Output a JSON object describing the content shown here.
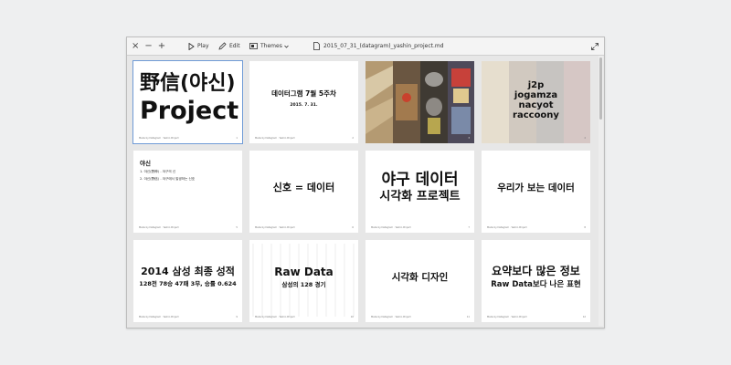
{
  "toolbar": {
    "close_icon": "×",
    "minimize_icon": "−",
    "add_icon": "+",
    "play_label": "Play",
    "edit_label": "Edit",
    "themes_label": "Themes",
    "file_name": "2015_07_31_(datagram)_yashin_project.md"
  },
  "slides": [
    {
      "title_line1": "野信(야신)",
      "title_line2": "Project",
      "footer": "Made by Datagram · Yashin Project",
      "page": "1"
    },
    {
      "title": "데이터그램 7월 5주차",
      "subtitle": "2015. 7. 31.",
      "footer": "Made by Datagram · Yashin Project",
      "page": "2"
    },
    {
      "image": "baseball-photo-collage",
      "page": "3"
    },
    {
      "line1": "j2p",
      "line2": "jogamza",
      "line3": "nacyot",
      "line4": "raccoony",
      "image": "faded-photo-collage",
      "page": "4"
    },
    {
      "heading": "야신",
      "item1": "1. 야신(野神) - 야구의 신",
      "item2": "2. 야신(野信) - 야구에서 발생하는 신호",
      "footer": "Made by Datagram · Yashin Project",
      "page": "5"
    },
    {
      "title": "신호 = 데이터",
      "footer": "Made by Datagram · Yashin Project",
      "page": "6"
    },
    {
      "line1": "야구 데이터",
      "line2": "시각화 프로젝트",
      "footer": "Made by Datagram · Yashin Project",
      "page": "7"
    },
    {
      "title": "우리가 보는 데이터",
      "footer": "Made by Datagram · Yashin Project",
      "page": "8"
    },
    {
      "line1": "2014 삼성 최종 성적",
      "line2": "128전 78승 47패 3무, 승률 0.624",
      "footer": "Made by Datagram · Yashin Project",
      "page": "9"
    },
    {
      "title": "Raw Data",
      "subtitle": "삼성의 128 경기",
      "footer": "Made by Datagram · Yashin Project",
      "page": "10"
    },
    {
      "title": "시각화 디자인",
      "footer": "Made by Datagram · Yashin Project",
      "page": "11"
    },
    {
      "line1": "요약보다 많은 정보",
      "line2": "Raw Data보다 나은 표현",
      "footer": "Made by Datagram · Yashin Project",
      "page": "12"
    }
  ]
}
